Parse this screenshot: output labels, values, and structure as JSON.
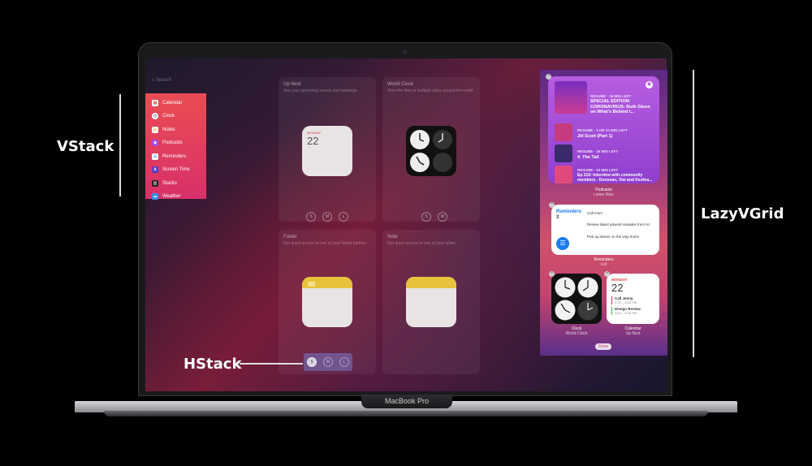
{
  "annotations": {
    "vstack": "VStack",
    "hstack": "HStack",
    "lazyvgrid": "LazyVGrid"
  },
  "laptop": {
    "model": "MacBook Pro"
  },
  "sidebar": {
    "search_placeholder": "Search",
    "items": [
      {
        "label": "Calendar",
        "icon": "calendar-icon"
      },
      {
        "label": "Clock",
        "icon": "clock-icon"
      },
      {
        "label": "Notes",
        "icon": "notes-icon"
      },
      {
        "label": "Podcasts",
        "icon": "podcasts-icon"
      },
      {
        "label": "Reminders",
        "icon": "reminders-icon"
      },
      {
        "label": "Screen Time",
        "icon": "screen-time-icon"
      },
      {
        "label": "Stacks",
        "icon": "stacks-icon"
      },
      {
        "label": "Weather",
        "icon": "weather-icon"
      }
    ]
  },
  "gallery": {
    "up_next": {
      "title": "Up Next",
      "desc": "See your upcoming events and meetings.",
      "day": "MONDAY",
      "date": "22"
    },
    "world_clock": {
      "title": "World Clock",
      "desc": "View the time in multiple cities around the world."
    },
    "folder": {
      "title": "Folder",
      "desc": "Get quick access to one of your Notes folders."
    },
    "note": {
      "title": "Note",
      "desc": "Get quick access to one of your notes."
    },
    "sizes": [
      "S",
      "M",
      "L"
    ]
  },
  "widgets": {
    "podcasts": {
      "label": "Podcasts",
      "sub": "Listen Now",
      "featured": {
        "meta": "RESUME · 16 MIN LEFT",
        "title": "SPECIAL EDITION: CORONAVIRUS: Ruth Glenn on What's Behind t..."
      },
      "items": [
        {
          "meta": "RESUME · 1 HR 23 MIN LEFT",
          "title": "Jill Scott (Part 1)"
        },
        {
          "meta": "RESUME · 16 MIN LEFT",
          "title": "4. The Tail"
        },
        {
          "meta": "RESUME · 53 MIN LEFT",
          "title": "Ep 210: Interview with community members - Donovan, Visi and Keshra..."
        }
      ]
    },
    "reminders": {
      "label": "Reminders",
      "sub": "List",
      "title": "Reminders",
      "count": "3",
      "items": [
        "Call mom",
        "Review latest artwork samples from HI",
        "Pick up dinner on the way home"
      ]
    },
    "clock": {
      "label": "Clock",
      "sub": "World Clock"
    },
    "calendar": {
      "label": "Calendar",
      "sub": "Up Next",
      "day": "MONDAY",
      "date": "22",
      "events": [
        {
          "title": "Call Jenny",
          "time": "2:00 – 3:00 PM"
        },
        {
          "title": "Design Review",
          "time": "3:00 – 4:00 PM"
        }
      ]
    },
    "done_label": "Done"
  },
  "colors": {
    "sidebar": "#e3415b",
    "panel_top": "#5b2a84",
    "panel_mid": "#d0526a",
    "reminders_blue": "#1a7cf5",
    "calendar_red": "#e5383b"
  }
}
